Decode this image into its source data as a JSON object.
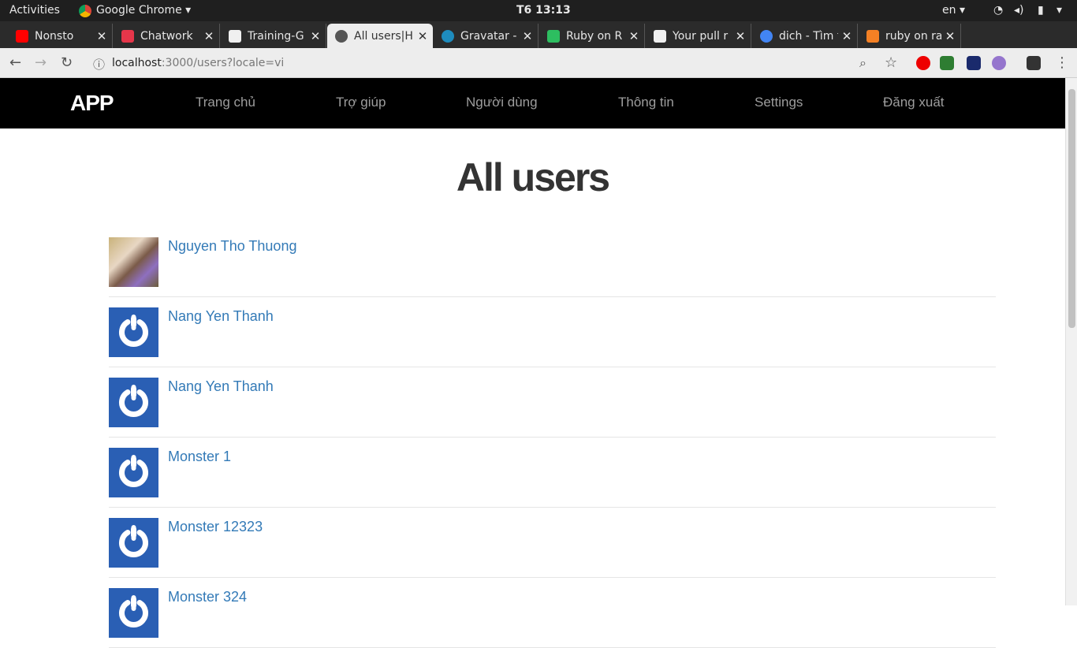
{
  "os": {
    "activities": "Activities",
    "app": "Google Chrome",
    "clock": "T6 13:13",
    "lang": "en"
  },
  "tabs": [
    {
      "title": "Nonsto",
      "favicon": "youtube-icon",
      "color": "#ff0000"
    },
    {
      "title": "Chatwork",
      "favicon": "chatwork-icon",
      "color": "#e6364a"
    },
    {
      "title": "Training-G",
      "favicon": "github-icon",
      "color": "#f0f0f0"
    },
    {
      "title": "All users|H",
      "favicon": "globe-icon",
      "color": "#555555"
    },
    {
      "title": "Gravatar -",
      "favicon": "gravatar-icon",
      "color": "#1e8cbe"
    },
    {
      "title": "Ruby on R",
      "favicon": "evernote-icon",
      "color": "#2dbe60"
    },
    {
      "title": "Your pull r",
      "favicon": "github-icon",
      "color": "#f0f0f0"
    },
    {
      "title": "dich - Tìm t",
      "favicon": "google-icon",
      "color": "#4285f4"
    },
    {
      "title": "ruby on ra",
      "favicon": "stackoverflow-icon",
      "color": "#f48024"
    }
  ],
  "address": {
    "host": "localhost",
    "rest": ":3000/users?locale=vi"
  },
  "nav": {
    "brand": "APP",
    "links": [
      "Trang chủ",
      "Trợ giúp",
      "Người dùng",
      "Thông tin",
      "Settings",
      "Đăng xuất"
    ]
  },
  "page": {
    "title": "All users"
  },
  "users": [
    {
      "name": "Nguyen Tho Thuong",
      "avatar": "photo"
    },
    {
      "name": "Nang Yen Thanh",
      "avatar": "gravatar"
    },
    {
      "name": "Nang Yen Thanh",
      "avatar": "gravatar"
    },
    {
      "name": "Monster 1",
      "avatar": "gravatar"
    },
    {
      "name": "Monster 12323",
      "avatar": "gravatar"
    },
    {
      "name": "Monster 324",
      "avatar": "gravatar"
    }
  ],
  "colors": {
    "navbar": "#000000",
    "link": "#337ab7",
    "gravatar": "#2a5fb4"
  }
}
